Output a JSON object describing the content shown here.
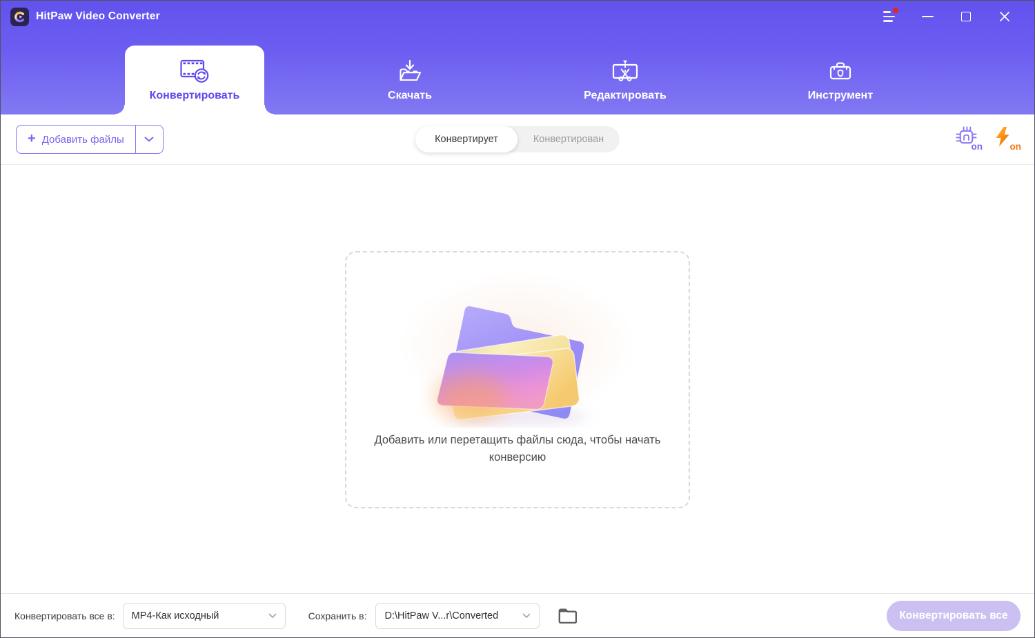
{
  "window": {
    "title": "HitPaw Video Converter"
  },
  "header": {
    "tabs": [
      {
        "label": "Конвертировать",
        "active": true
      },
      {
        "label": "Скачать",
        "active": false
      },
      {
        "label": "Редактировать",
        "active": false
      },
      {
        "label": "Инструмент",
        "active": false
      }
    ]
  },
  "toolbar": {
    "add_files_label": "Добавить файлы",
    "filters": [
      {
        "label": "Конвертирует",
        "active": true
      },
      {
        "label": "Конвертирован",
        "active": false
      }
    ],
    "hw_accel_badge": "on",
    "turbo_badge": "on"
  },
  "dropzone": {
    "caption": "Добавить или перетащить файлы сюда, чтобы начать конверсию"
  },
  "footer": {
    "convert_all_label": "Конвертировать все в:",
    "format_value": "MP4-Как исходный",
    "save_label": "Сохранить в:",
    "save_path": "D:\\HitPaw V...r\\Converted",
    "convert_button_label": "Конвертировать все"
  },
  "colors": {
    "accent": "#6c5bf0",
    "header_gradient_top": "#6252ee",
    "header_gradient_bottom": "#8279f3",
    "turbo_orange": "#f4730c",
    "disabled_button": "#cbc0f1",
    "logo_background": "#2a2450"
  }
}
